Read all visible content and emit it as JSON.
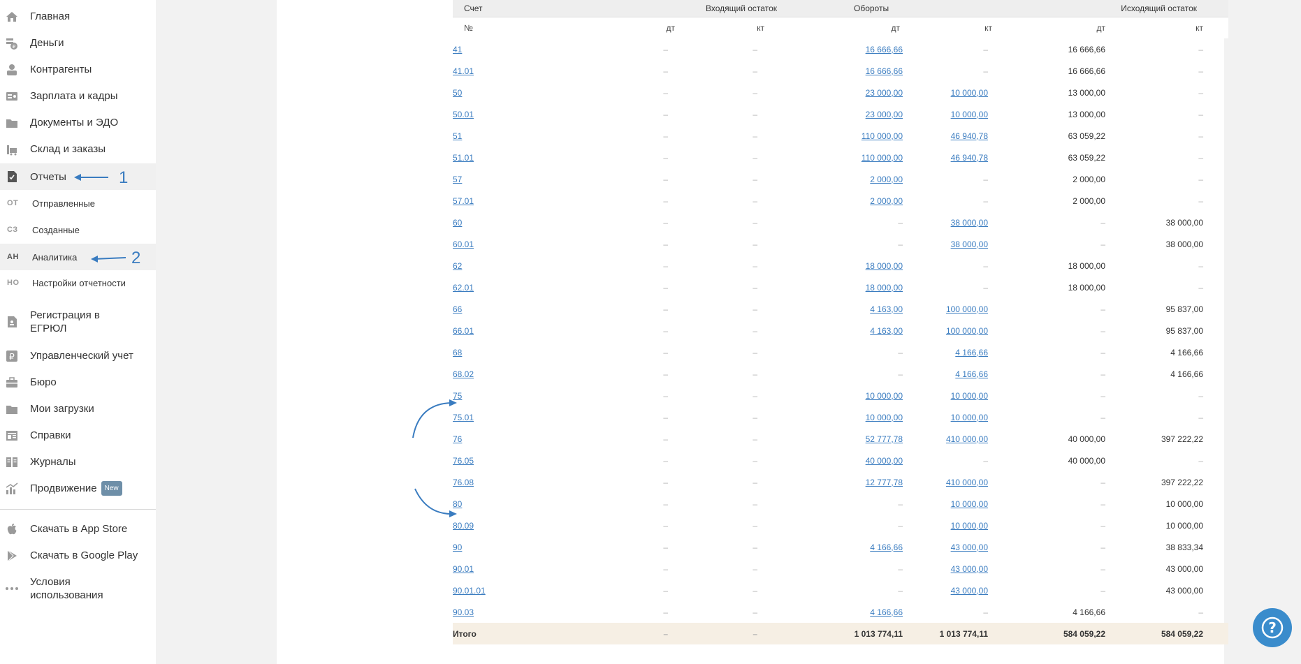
{
  "sidebar": {
    "items": [
      {
        "label": "Главная",
        "icon": "home-icon"
      },
      {
        "label": "Деньги",
        "icon": "money-icon"
      },
      {
        "label": "Контрагенты",
        "icon": "contractors-icon"
      },
      {
        "label": "Зарплата и кадры",
        "icon": "salary-icon"
      },
      {
        "label": "Документы и ЭДО",
        "icon": "folder-icon"
      },
      {
        "label": "Склад и заказы",
        "icon": "warehouse-icon"
      },
      {
        "label": "Отчеты",
        "icon": "report-icon"
      }
    ],
    "subitems": [
      {
        "abbr": "ОТ",
        "label": "Отправленные"
      },
      {
        "abbr": "СЗ",
        "label": "Созданные"
      },
      {
        "abbr": "АН",
        "label": "Аналитика"
      },
      {
        "abbr": "НО",
        "label": "Настройки отчетности"
      }
    ],
    "items2": [
      {
        "label": "Регистрация в ЕГРЮЛ",
        "icon": "registration-icon"
      },
      {
        "label": "Управленческий учет",
        "icon": "ruble-icon"
      },
      {
        "label": "Бюро",
        "icon": "briefcase-icon"
      },
      {
        "label": "Мои загрузки",
        "icon": "folder-icon"
      },
      {
        "label": "Справки",
        "icon": "certificate-icon"
      },
      {
        "label": "Журналы",
        "icon": "journal-icon"
      },
      {
        "label": "Продвижение",
        "icon": "promotion-icon",
        "badge": "New"
      }
    ],
    "bottom": [
      {
        "label": "Скачать в App Store",
        "icon": "apple-icon"
      },
      {
        "label": "Скачать в Google Play",
        "icon": "google-play-icon"
      },
      {
        "label": "Условия использования",
        "icon": "more-icon"
      }
    ]
  },
  "table": {
    "header": {
      "account": "Счет",
      "opening": "Входящий остаток",
      "turnover": "Обороты",
      "closing": "Исходящий остаток",
      "number": "№",
      "dt": "дт",
      "kt": "кт"
    },
    "rows": [
      {
        "acc": "41",
        "sub": false,
        "ob_dt": "–",
        "ob_kt": "–",
        "to_dt": "16 666,66",
        "to_kt": "–",
        "cb_dt": "16 666,66",
        "cb_kt": "–"
      },
      {
        "acc": "41.01",
        "sub": true,
        "ob_dt": "–",
        "ob_kt": "–",
        "to_dt": "16 666,66",
        "to_kt": "–",
        "cb_dt": "16 666,66",
        "cb_kt": "–"
      },
      {
        "acc": "50",
        "sub": false,
        "ob_dt": "–",
        "ob_kt": "–",
        "to_dt": "23 000,00",
        "to_kt": "10 000,00",
        "cb_dt": "13 000,00",
        "cb_kt": "–"
      },
      {
        "acc": "50.01",
        "sub": true,
        "ob_dt": "–",
        "ob_kt": "–",
        "to_dt": "23 000,00",
        "to_kt": "10 000,00",
        "cb_dt": "13 000,00",
        "cb_kt": "–"
      },
      {
        "acc": "51",
        "sub": false,
        "ob_dt": "–",
        "ob_kt": "–",
        "to_dt": "110 000,00",
        "to_kt": "46 940,78",
        "cb_dt": "63 059,22",
        "cb_kt": "–"
      },
      {
        "acc": "51.01",
        "sub": true,
        "ob_dt": "–",
        "ob_kt": "–",
        "to_dt": "110 000,00",
        "to_kt": "46 940,78",
        "cb_dt": "63 059,22",
        "cb_kt": "–"
      },
      {
        "acc": "57",
        "sub": false,
        "ob_dt": "–",
        "ob_kt": "–",
        "to_dt": "2 000,00",
        "to_kt": "–",
        "cb_dt": "2 000,00",
        "cb_kt": "–"
      },
      {
        "acc": "57.01",
        "sub": true,
        "ob_dt": "–",
        "ob_kt": "–",
        "to_dt": "2 000,00",
        "to_kt": "–",
        "cb_dt": "2 000,00",
        "cb_kt": "–"
      },
      {
        "acc": "60",
        "sub": false,
        "ob_dt": "–",
        "ob_kt": "–",
        "to_dt": "–",
        "to_kt": "38 000,00",
        "cb_dt": "–",
        "cb_kt": "38 000,00"
      },
      {
        "acc": "60.01",
        "sub": true,
        "ob_dt": "–",
        "ob_kt": "–",
        "to_dt": "–",
        "to_kt": "38 000,00",
        "cb_dt": "–",
        "cb_kt": "38 000,00"
      },
      {
        "acc": "62",
        "sub": false,
        "ob_dt": "–",
        "ob_kt": "–",
        "to_dt": "18 000,00",
        "to_kt": "–",
        "cb_dt": "18 000,00",
        "cb_kt": "–"
      },
      {
        "acc": "62.01",
        "sub": true,
        "ob_dt": "–",
        "ob_kt": "–",
        "to_dt": "18 000,00",
        "to_kt": "–",
        "cb_dt": "18 000,00",
        "cb_kt": "–"
      },
      {
        "acc": "66",
        "sub": false,
        "ob_dt": "–",
        "ob_kt": "–",
        "to_dt": "4 163,00",
        "to_kt": "100 000,00",
        "cb_dt": "–",
        "cb_kt": "95 837,00"
      },
      {
        "acc": "66.01",
        "sub": true,
        "ob_dt": "–",
        "ob_kt": "–",
        "to_dt": "4 163,00",
        "to_kt": "100 000,00",
        "cb_dt": "–",
        "cb_kt": "95 837,00"
      },
      {
        "acc": "68",
        "sub": false,
        "ob_dt": "–",
        "ob_kt": "–",
        "to_dt": "–",
        "to_kt": "4 166,66",
        "cb_dt": "–",
        "cb_kt": "4 166,66"
      },
      {
        "acc": "68.02",
        "sub": true,
        "ob_dt": "–",
        "ob_kt": "–",
        "to_dt": "–",
        "to_kt": "4 166,66",
        "cb_dt": "–",
        "cb_kt": "4 166,66"
      },
      {
        "acc": "75",
        "sub": false,
        "ob_dt": "–",
        "ob_kt": "–",
        "to_dt": "10 000,00",
        "to_kt": "10 000,00",
        "cb_dt": "–",
        "cb_kt": "–"
      },
      {
        "acc": "75.01",
        "sub": true,
        "ob_dt": "–",
        "ob_kt": "–",
        "to_dt": "10 000,00",
        "to_kt": "10 000,00",
        "cb_dt": "–",
        "cb_kt": "–"
      },
      {
        "acc": "76",
        "sub": false,
        "ob_dt": "–",
        "ob_kt": "–",
        "to_dt": "52 777,78",
        "to_kt": "410 000,00",
        "cb_dt": "40 000,00",
        "cb_kt": "397 222,22"
      },
      {
        "acc": "76.05",
        "sub": true,
        "ob_dt": "–",
        "ob_kt": "–",
        "to_dt": "40 000,00",
        "to_kt": "–",
        "cb_dt": "40 000,00",
        "cb_kt": "–"
      },
      {
        "acc": "76.08",
        "sub": true,
        "ob_dt": "–",
        "ob_kt": "–",
        "to_dt": "12 777,78",
        "to_kt": "410 000,00",
        "cb_dt": "–",
        "cb_kt": "397 222,22"
      },
      {
        "acc": "80",
        "sub": false,
        "ob_dt": "–",
        "ob_kt": "–",
        "to_dt": "–",
        "to_kt": "10 000,00",
        "cb_dt": "–",
        "cb_kt": "10 000,00"
      },
      {
        "acc": "80.09",
        "sub": true,
        "ob_dt": "–",
        "ob_kt": "–",
        "to_dt": "–",
        "to_kt": "10 000,00",
        "cb_dt": "–",
        "cb_kt": "10 000,00"
      },
      {
        "acc": "90",
        "sub": false,
        "ob_dt": "–",
        "ob_kt": "–",
        "to_dt": "4 166,66",
        "to_kt": "43 000,00",
        "cb_dt": "–",
        "cb_kt": "38 833,34"
      },
      {
        "acc": "90.01",
        "sub": true,
        "ob_dt": "–",
        "ob_kt": "–",
        "to_dt": "–",
        "to_kt": "43 000,00",
        "cb_dt": "–",
        "cb_kt": "43 000,00"
      },
      {
        "acc": "90.01.01",
        "sub": true,
        "ob_dt": "–",
        "ob_kt": "–",
        "to_dt": "–",
        "to_kt": "43 000,00",
        "cb_dt": "–",
        "cb_kt": "43 000,00"
      },
      {
        "acc": "90.03",
        "sub": true,
        "ob_dt": "–",
        "ob_kt": "–",
        "to_dt": "4 166,66",
        "to_kt": "–",
        "cb_dt": "4 166,66",
        "cb_kt": "–"
      }
    ],
    "total": {
      "label": "Итого",
      "ob_dt": "–",
      "ob_kt": "–",
      "to_dt": "1 013 774,11",
      "to_kt": "1 013 774,11",
      "cb_dt": "584 059,22",
      "cb_kt": "584 059,22"
    }
  },
  "annotations": {
    "label1": "1",
    "label2": "2",
    "color": "#3a7cc0"
  },
  "help": {
    "icon": "question-icon",
    "symbol": "?"
  }
}
